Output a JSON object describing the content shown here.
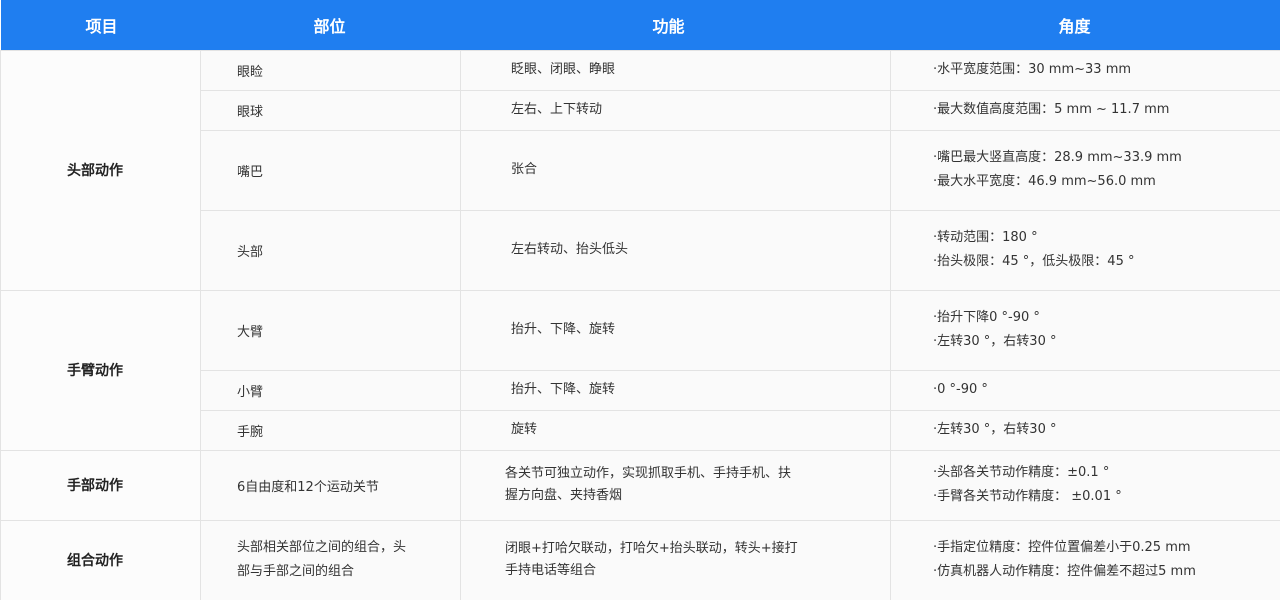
{
  "header": {
    "col_item": "项目",
    "col_part": "部位",
    "col_function": "功能",
    "col_angle": "角度"
  },
  "groups": {
    "head": "头部动作",
    "arm": "手臂动作",
    "hand": "手部动作",
    "combo": "组合动作"
  },
  "rows": [
    {
      "part": "眼睑",
      "function": "眨眼、闭眼、睁眼",
      "angle": [
        "·水平宽度范围：30 mm~33 mm"
      ]
    },
    {
      "part": "眼球",
      "function": "左右、上下转动",
      "angle": [
        "·最大数值高度范围：5 mm ~ 11.7 mm"
      ]
    },
    {
      "part": "嘴巴",
      "function": "张合",
      "angle": [
        "·嘴巴最大竖直高度：28.9 mm~33.9 mm",
        "·最大水平宽度：46.9 mm~56.0 mm"
      ]
    },
    {
      "part": "头部",
      "function": "左右转动、抬头低头",
      "angle": [
        "·转动范围：180 °",
        "·抬头极限：45 °，低头极限：45 °"
      ]
    },
    {
      "part": "大臂",
      "function": "抬升、下降、旋转",
      "angle": [
        "·抬升下降0 °-90 °",
        "·左转30 °，右转30 °"
      ]
    },
    {
      "part": "小臂",
      "function": "抬升、下降、旋转",
      "angle": [
        "·0 °-90 °"
      ]
    },
    {
      "part": "手腕",
      "function": "旋转",
      "angle": [
        "·左转30 °，右转30 °"
      ]
    },
    {
      "part": "6自由度和12个运动关节",
      "function": [
        "各关节可独立动作，实现抓取手机、手持手机、扶",
        "握方向盘、夹持香烟"
      ],
      "angle": [
        "·头部各关节动作精度：±0.1 °",
        "·手臂各关节动作精度： ±0.01 °"
      ]
    },
    {
      "part": [
        "头部相关部位之间的组合，头",
        "部与手部之间的组合"
      ],
      "function": [
        "闭眼+打哈欠联动，打哈欠+抬头联动，转头+接打",
        "手持电话等组合"
      ],
      "angle": [
        "·手指定位精度：控件位置偏差小于0.25 mm",
        "·仿真机器人动作精度：控件偏差不超过5 mm"
      ]
    }
  ]
}
